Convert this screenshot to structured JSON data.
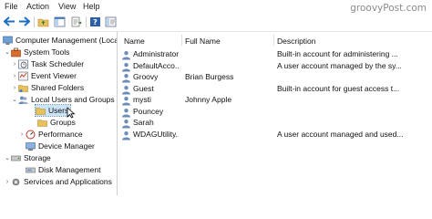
{
  "menu": [
    "File",
    "Action",
    "View",
    "Help"
  ],
  "watermark": "groovyPost.com",
  "toolbar_icons": [
    "back-arrow-icon",
    "forward-arrow-icon",
    "up-folder-icon",
    "show-hide-tree-icon",
    "export-list-icon",
    "help-icon",
    "properties-icon"
  ],
  "tree": {
    "root": "Computer Management (Local)",
    "system_tools": "System Tools",
    "task_scheduler": "Task Scheduler",
    "event_viewer": "Event Viewer",
    "shared_folders": "Shared Folders",
    "local_users": "Local Users and Groups",
    "users": "Users",
    "groups": "Groups",
    "performance": "Performance",
    "device_manager": "Device Manager",
    "storage": "Storage",
    "disk_management": "Disk Management",
    "services": "Services and Applications"
  },
  "columns": {
    "name": "Name",
    "full_name": "Full Name",
    "description": "Description"
  },
  "users": [
    {
      "name": "Administrator",
      "full_name": "",
      "description": "Built-in account for administering ..."
    },
    {
      "name": "DefaultAcco...",
      "full_name": "",
      "description": "A user account managed by the sy..."
    },
    {
      "name": "Groovy",
      "full_name": "Brian Burgess",
      "description": ""
    },
    {
      "name": "Guest",
      "full_name": "",
      "description": "Built-in account for guest access t..."
    },
    {
      "name": "mysti",
      "full_name": "Johnny Apple",
      "description": ""
    },
    {
      "name": "Pouncey",
      "full_name": "",
      "description": ""
    },
    {
      "name": "Sarah",
      "full_name": "",
      "description": ""
    },
    {
      "name": "WDAGUtility...",
      "full_name": "",
      "description": "A user account managed and used..."
    }
  ]
}
